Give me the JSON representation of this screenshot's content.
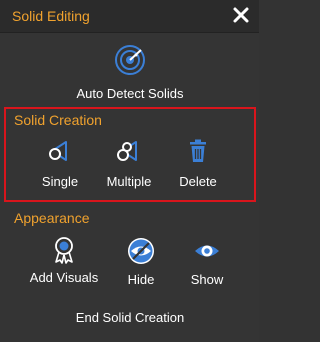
{
  "header": {
    "title": "Solid Editing",
    "close_icon": "close-icon"
  },
  "auto_detect": {
    "label": "Auto Detect Solids",
    "icon": "radar-target-icon"
  },
  "solid_creation": {
    "section_label": "Solid Creation",
    "tools": [
      {
        "label": "Single",
        "icon": "single-solid-icon"
      },
      {
        "label": "Multiple",
        "icon": "multiple-solids-icon"
      },
      {
        "label": "Delete",
        "icon": "trash-icon"
      }
    ]
  },
  "appearance": {
    "section_label": "Appearance",
    "tools": [
      {
        "label": "Add Visuals",
        "icon": "badge-icon"
      },
      {
        "label": "Hide",
        "icon": "eye-slash-icon"
      },
      {
        "label": "Show",
        "icon": "eye-icon"
      }
    ]
  },
  "footer": {
    "end_label": "End Solid Creation"
  },
  "colors": {
    "accent": "#f0a22e",
    "icon_blue": "#3b7fd6",
    "highlight_red": "#d9151c",
    "background": "#343434"
  }
}
